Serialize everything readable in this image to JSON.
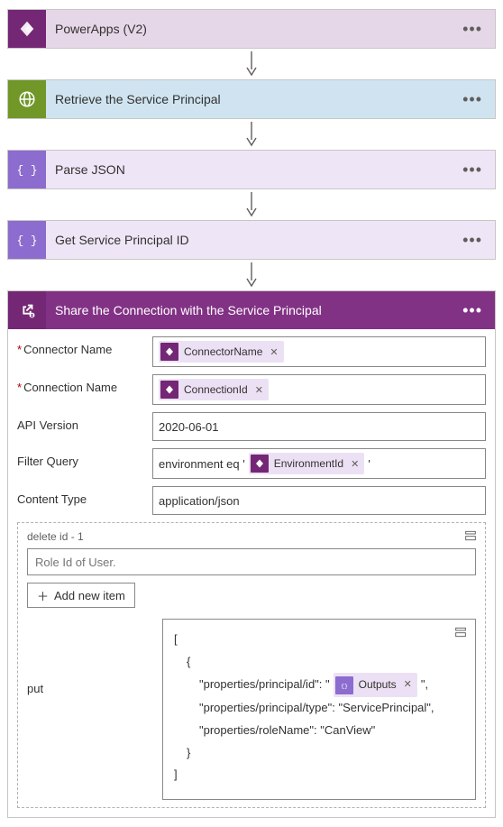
{
  "steps": {
    "powerapps": {
      "title": "PowerApps (V2)"
    },
    "retrieve": {
      "title": "Retrieve the Service Principal"
    },
    "parse": {
      "title": "Parse JSON"
    },
    "getid": {
      "title": "Get Service Principal ID"
    },
    "share": {
      "title": "Share the Connection with the Service Principal"
    }
  },
  "fields": {
    "connector_name_label": "Connector Name",
    "connection_name_label": "Connection Name",
    "api_version_label": "API Version",
    "api_version_value": "2020-06-01",
    "filter_label": "Filter Query",
    "filter_prefix": "environment eq '",
    "content_type_label": "Content Type",
    "content_type_value": "application/json"
  },
  "tokens": {
    "connector_name": "ConnectorName",
    "connection_id": "ConnectionId",
    "environment_id": "EnvironmentId",
    "outputs": "Outputs"
  },
  "delete_section": {
    "title": "delete id - 1",
    "placeholder": "Role Id of User.",
    "add_label": "Add new item"
  },
  "put_section": {
    "label": "put",
    "line0": "[",
    "line1": "{",
    "line2a": "\"properties/principal/id\": \"",
    "line2b": "\",",
    "line3": "\"properties/principal/type\": \"ServicePrincipal\",",
    "line4": "\"properties/roleName\": \"CanView\"",
    "line5": "}",
    "line6": "]"
  }
}
